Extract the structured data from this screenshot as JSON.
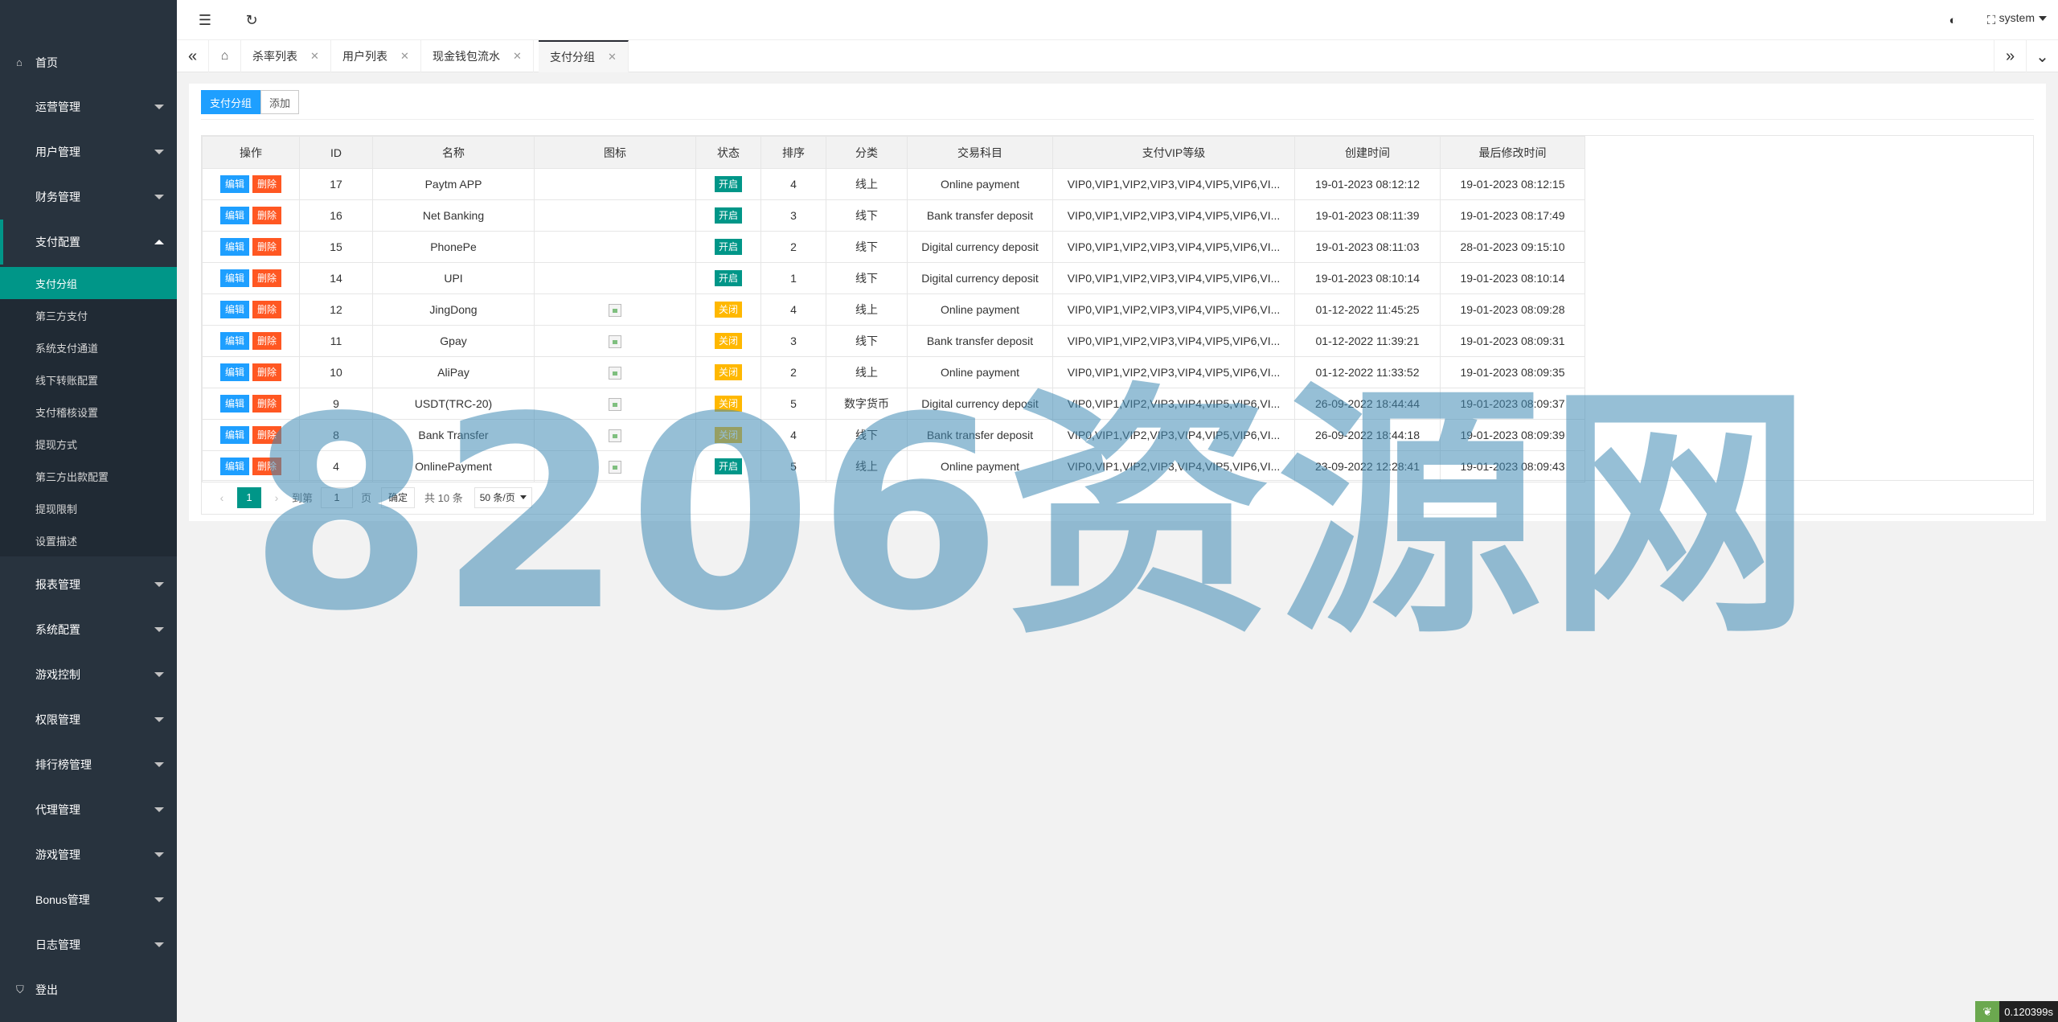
{
  "sidebar": {
    "home": "首页",
    "menus": [
      {
        "label": "运营管理"
      },
      {
        "label": "用户管理"
      },
      {
        "label": "财务管理"
      },
      {
        "label": "支付配置"
      },
      {
        "label": "报表管理"
      },
      {
        "label": "系统配置"
      },
      {
        "label": "游戏控制"
      },
      {
        "label": "权限管理"
      },
      {
        "label": "排行榜管理"
      },
      {
        "label": "代理管理"
      },
      {
        "label": "游戏管理"
      },
      {
        "label": "Bonus管理"
      },
      {
        "label": "日志管理"
      }
    ],
    "submenu": [
      "支付分组",
      "第三方支付",
      "系统支付通道",
      "线下转账配置",
      "支付稽核设置",
      "提现方式",
      "第三方出款配置",
      "提现限制",
      "设置描述"
    ],
    "logout": "登出"
  },
  "header": {
    "user": "system"
  },
  "tabs": [
    "杀率列表",
    "用户列表",
    "现金钱包流水",
    "支付分组"
  ],
  "toolbar": {
    "group_btn": "支付分组",
    "add_btn": "添加"
  },
  "table": {
    "columns": [
      "操作",
      "ID",
      "名称",
      "图标",
      "状态",
      "排序",
      "分类",
      "交易科目",
      "支付VIP等级",
      "创建时间",
      "最后修改时间"
    ],
    "edit_label": "编辑",
    "delete_label": "删除",
    "rows": [
      {
        "id": "17",
        "name": "Paytm APP",
        "icon": false,
        "status": "开启",
        "status_on": true,
        "sort": "4",
        "category": "线上",
        "subject": "Online payment",
        "vip": "VIP0,VIP1,VIP2,VIP3,VIP4,VIP5,VIP6,VI...",
        "created": "19-01-2023 08:12:12",
        "modified": "19-01-2023 08:12:15"
      },
      {
        "id": "16",
        "name": "Net Banking",
        "icon": false,
        "status": "开启",
        "status_on": true,
        "sort": "3",
        "category": "线下",
        "subject": "Bank transfer deposit",
        "vip": "VIP0,VIP1,VIP2,VIP3,VIP4,VIP5,VIP6,VI...",
        "created": "19-01-2023 08:11:39",
        "modified": "19-01-2023 08:17:49"
      },
      {
        "id": "15",
        "name": "PhonePe",
        "icon": false,
        "status": "开启",
        "status_on": true,
        "sort": "2",
        "category": "线下",
        "subject": "Digital currency deposit",
        "vip": "VIP0,VIP1,VIP2,VIP3,VIP4,VIP5,VIP6,VI...",
        "created": "19-01-2023 08:11:03",
        "modified": "28-01-2023 09:15:10"
      },
      {
        "id": "14",
        "name": "UPI",
        "icon": false,
        "status": "开启",
        "status_on": true,
        "sort": "1",
        "category": "线下",
        "subject": "Digital currency deposit",
        "vip": "VIP0,VIP1,VIP2,VIP3,VIP4,VIP5,VIP6,VI...",
        "created": "19-01-2023 08:10:14",
        "modified": "19-01-2023 08:10:14"
      },
      {
        "id": "12",
        "name": "JingDong",
        "icon": true,
        "status": "关闭",
        "status_on": false,
        "sort": "4",
        "category": "线上",
        "subject": "Online payment",
        "vip": "VIP0,VIP1,VIP2,VIP3,VIP4,VIP5,VIP6,VI...",
        "created": "01-12-2022 11:45:25",
        "modified": "19-01-2023 08:09:28"
      },
      {
        "id": "11",
        "name": "Gpay",
        "icon": true,
        "status": "关闭",
        "status_on": false,
        "sort": "3",
        "category": "线下",
        "subject": "Bank transfer deposit",
        "vip": "VIP0,VIP1,VIP2,VIP3,VIP4,VIP5,VIP6,VI...",
        "created": "01-12-2022 11:39:21",
        "modified": "19-01-2023 08:09:31"
      },
      {
        "id": "10",
        "name": "AliPay",
        "icon": true,
        "status": "关闭",
        "status_on": false,
        "sort": "2",
        "category": "线上",
        "subject": "Online payment",
        "vip": "VIP0,VIP1,VIP2,VIP3,VIP4,VIP5,VIP6,VI...",
        "created": "01-12-2022 11:33:52",
        "modified": "19-01-2023 08:09:35"
      },
      {
        "id": "9",
        "name": "USDT(TRC-20)",
        "icon": true,
        "status": "关闭",
        "status_on": false,
        "sort": "5",
        "category": "数字货币",
        "subject": "Digital currency deposit",
        "vip": "VIP0,VIP1,VIP2,VIP3,VIP4,VIP5,VIP6,VI...",
        "created": "26-09-2022 18:44:44",
        "modified": "19-01-2023 08:09:37"
      },
      {
        "id": "8",
        "name": "Bank Transfer",
        "icon": true,
        "status": "关闭",
        "status_on": false,
        "sort": "4",
        "category": "线下",
        "subject": "Bank transfer deposit",
        "vip": "VIP0,VIP1,VIP2,VIP3,VIP4,VIP5,VIP6,VI...",
        "created": "26-09-2022 18:44:18",
        "modified": "19-01-2023 08:09:39"
      },
      {
        "id": "4",
        "name": "OnlinePayment",
        "icon": true,
        "status": "开启",
        "status_on": true,
        "sort": "5",
        "category": "线上",
        "subject": "Online payment",
        "vip": "VIP0,VIP1,VIP2,VIP3,VIP4,VIP5,VIP6,VI...",
        "created": "23-09-2022 12:28:41",
        "modified": "19-01-2023 08:09:43"
      }
    ]
  },
  "pager": {
    "current": "1",
    "goto_label": "到第",
    "input_value": "1",
    "page_unit": "页",
    "confirm": "确定",
    "total": "共 10 条",
    "per_page": "50 条/页"
  },
  "watermark": "8206资源网",
  "timer": "0.120399s",
  "colors": {
    "sidebar_bg": "#28333e",
    "accent": "#009688",
    "primary": "#1e9fff",
    "danger": "#ff5722",
    "warn": "#ffb800"
  }
}
